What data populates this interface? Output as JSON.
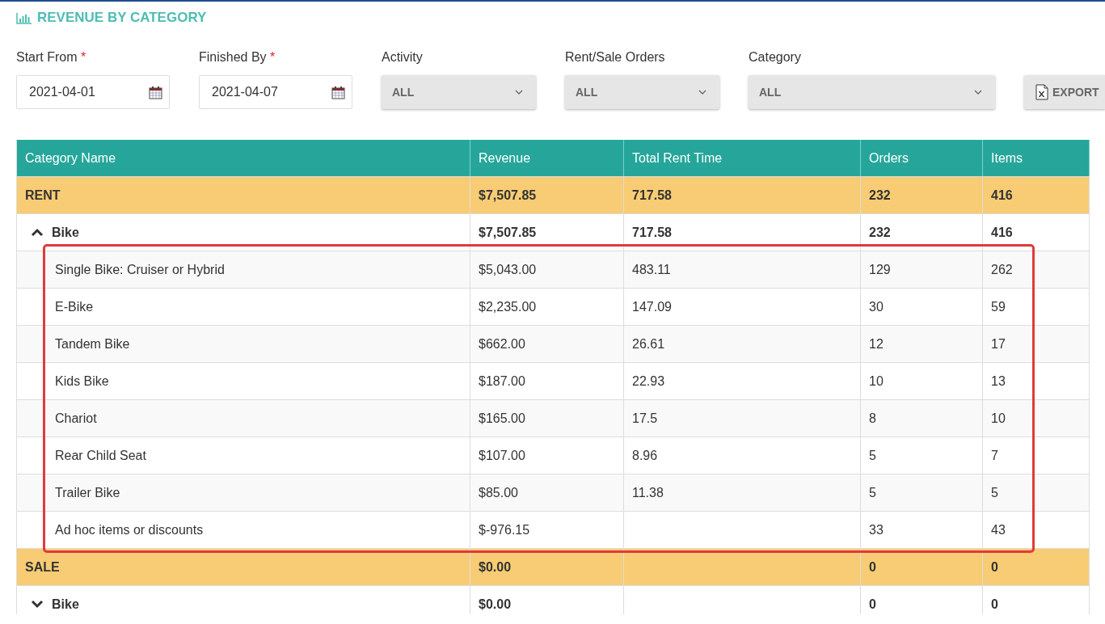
{
  "title": "REVENUE BY CATEGORY",
  "filters": [
    {
      "kind": "date",
      "label": "Start From",
      "required_mark": "*",
      "value": "2021-04-01"
    },
    {
      "kind": "date",
      "label": "Finished By",
      "required_mark": "*",
      "value": "2021-04-07"
    },
    {
      "kind": "select",
      "label": "Activity",
      "value": "ALL"
    },
    {
      "kind": "select",
      "label": "Rent/Sale Orders",
      "value": "ALL"
    },
    {
      "kind": "select",
      "label": "Category",
      "value": "ALL"
    }
  ],
  "export_button": "EXPORT",
  "table": {
    "columns": [
      "Category Name",
      "Revenue",
      "Total Rent Time",
      "Orders",
      "Items"
    ],
    "rows": [
      {
        "kind": "group",
        "cells": [
          "RENT",
          "$7,507.85",
          "717.58",
          "232",
          "416"
        ],
        "children": [
          {
            "kind": "subgroup",
            "expanded": true,
            "highlighted": true,
            "cells": [
              "Bike",
              "$7,507.85",
              "717.58",
              "232",
              "416"
            ],
            "children": [
              {
                "kind": "item",
                "cells": [
                  "Single Bike: Cruiser or Hybrid",
                  "$5,043.00",
                  "483.11",
                  "129",
                  "262"
                ]
              },
              {
                "kind": "item",
                "cells": [
                  "E-Bike",
                  "$2,235.00",
                  "147.09",
                  "30",
                  "59"
                ]
              },
              {
                "kind": "item",
                "cells": [
                  "Tandem Bike",
                  "$662.00",
                  "26.61",
                  "12",
                  "17"
                ]
              },
              {
                "kind": "item",
                "cells": [
                  "Kids Bike",
                  "$187.00",
                  "22.93",
                  "10",
                  "13"
                ]
              },
              {
                "kind": "item",
                "cells": [
                  "Chariot",
                  "$165.00",
                  "17.5",
                  "8",
                  "10"
                ]
              },
              {
                "kind": "item",
                "cells": [
                  "Rear Child Seat",
                  "$107.00",
                  "8.96",
                  "5",
                  "7"
                ]
              },
              {
                "kind": "item",
                "cells": [
                  "Trailer Bike",
                  "$85.00",
                  "11.38",
                  "5",
                  "5"
                ]
              },
              {
                "kind": "item",
                "cells": [
                  "Ad hoc items or discounts",
                  "$-976.15",
                  "",
                  "33",
                  "43"
                ]
              }
            ]
          }
        ]
      },
      {
        "kind": "group",
        "cells": [
          "SALE",
          "$0.00",
          "",
          "0",
          "0"
        ],
        "children": [
          {
            "kind": "subgroup",
            "expanded": false,
            "cells": [
              "Bike",
              "$0.00",
              "",
              "0",
              "0"
            ]
          }
        ]
      }
    ]
  }
}
